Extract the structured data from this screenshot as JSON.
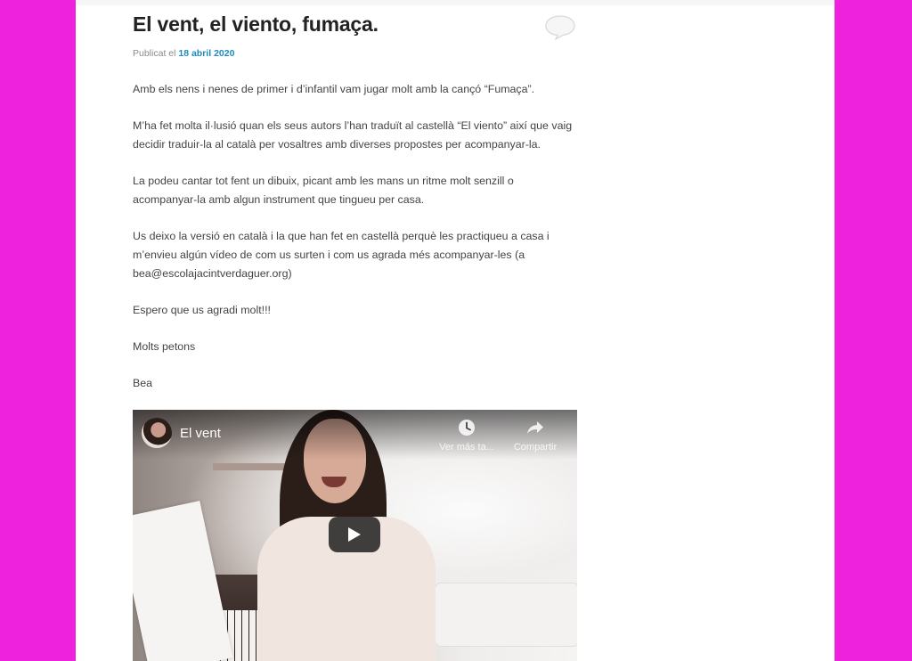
{
  "post": {
    "title": "El vent, el viento, fumaça.",
    "published_prefix": "Publicat el",
    "published_date": "18 abril 2020",
    "paragraphs": [
      "Amb els nens i nenes de primer i d’infantil vam jugar molt amb la cançó “Fumaça”.",
      "M’ha fet molta il·lusió quan els seus autors l’han traduït al castellà “El viento” així que vaig decidir traduir-la al català per vosaltres amb diverses propostes per acompanyar-la.",
      "La podeu cantar tot fent un dibuix, picant amb les mans un ritme molt senzill o acompanyar-la amb algun instrument que tingueu per casa.",
      "Us deixo la versió en català i la que han fet en castellà perquè les practiqueu a casa i m’envieu algún vídeo de com us surten i com us agrada més acompanyar-les (a bea@escolajacintverdaguer.org)",
      "Espero que us agradi molt!!!",
      "Molts petons",
      "Bea"
    ]
  },
  "video": {
    "title": "El vent",
    "watch_later_label": "Ver más ta...",
    "share_label": "Compartir"
  },
  "icons": {
    "comment": "speech-bubble-icon",
    "watch_later": "clock-icon",
    "share": "share-arrow-icon",
    "play": "play-icon"
  },
  "colors": {
    "background": "#ee22dd",
    "link": "#1e8cbe",
    "title": "#222222",
    "body_text": "#444444"
  }
}
